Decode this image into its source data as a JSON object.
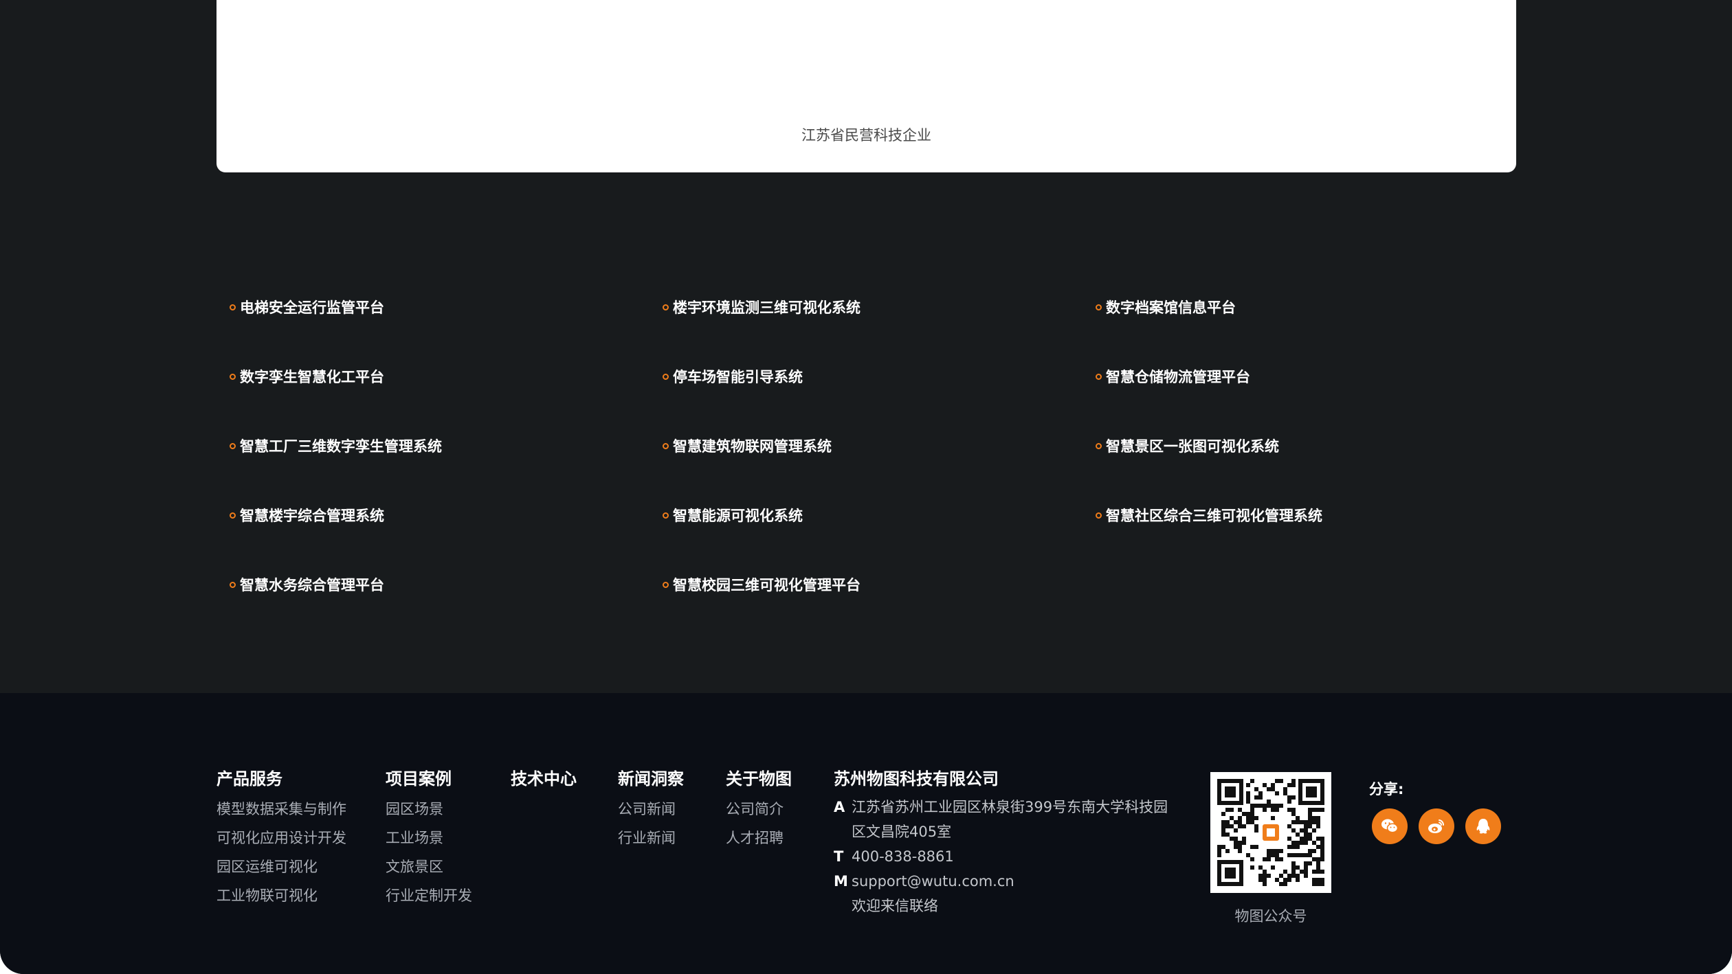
{
  "certificate": {
    "caption": "江苏省民营科技企业"
  },
  "projects": [
    "电梯安全运行监管平台",
    "楼宇环境监测三维可视化系统",
    "数字档案馆信息平台",
    "数字孪生智慧化工平台",
    "停车场智能引导系统",
    "智慧仓储物流管理平台",
    "智慧工厂三维数字孪生管理系统",
    "智慧建筑物联网管理系统",
    "智慧景区一张图可视化系统",
    "智慧楼宇综合管理系统",
    "智慧能源可视化系统",
    "智慧社区综合三维可视化管理系统",
    "智慧水务综合管理平台",
    "智慧校园三维可视化管理平台"
  ],
  "footer": {
    "products": {
      "title": "产品服务",
      "items": [
        "模型数据采集与制作",
        "可视化应用设计开发",
        "园区运维可视化",
        "工业物联可视化"
      ]
    },
    "cases": {
      "title": "项目案例",
      "items": [
        "园区场景",
        "工业场景",
        "文旅景区",
        "行业定制开发"
      ]
    },
    "tech": {
      "title": "技术中心"
    },
    "news": {
      "title": "新闻洞察",
      "items": [
        "公司新闻",
        "行业新闻"
      ]
    },
    "about": {
      "title": "关于物图",
      "items": [
        "公司简介",
        "人才招聘"
      ]
    },
    "company": {
      "title": "苏州物图科技有限公司",
      "address_tag": "A",
      "address_line1": "江苏省苏州工业园区林泉街399号东南大学科技园",
      "address_line2": "区文昌院405室",
      "phone_tag": "T",
      "phone": "400-838-8861",
      "mail_tag": "M",
      "email": "support@wutu.com.cn",
      "mail_note": "欢迎来信联络"
    },
    "qr_caption": "物图公众号",
    "share_label": "分享:",
    "share_icons": [
      "wechat-icon",
      "weibo-icon",
      "qq-icon"
    ]
  },
  "colors": {
    "accent": "#f07d1a",
    "section_bg": "#181b1d",
    "footer_bg": "#0b0e15"
  }
}
